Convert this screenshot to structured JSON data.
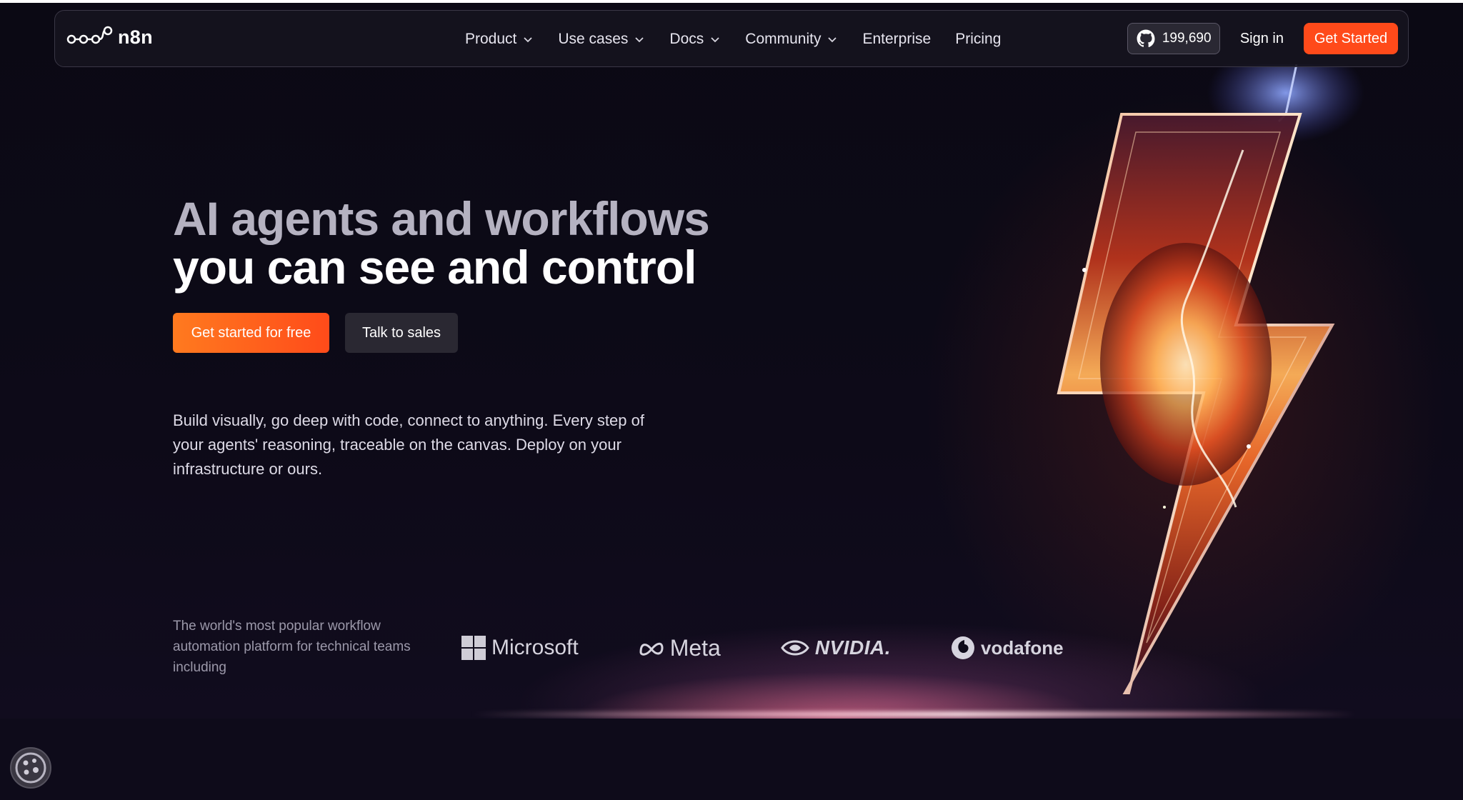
{
  "brand": {
    "name": "n8n"
  },
  "nav": {
    "menu": [
      {
        "label": "Product",
        "dropdown": true
      },
      {
        "label": "Use cases",
        "dropdown": true
      },
      {
        "label": "Docs",
        "dropdown": true
      },
      {
        "label": "Community",
        "dropdown": true
      },
      {
        "label": "Enterprise",
        "dropdown": false
      },
      {
        "label": "Pricing",
        "dropdown": false
      }
    ],
    "github_stars": "199,690",
    "signin_label": "Sign in",
    "get_started_label": "Get Started"
  },
  "hero": {
    "headline_line1": "AI agents and workflows",
    "headline_line2": "you can see and control",
    "cta_primary": "Get started for free",
    "cta_secondary": "Talk to sales",
    "description": "Build visually, go deep with code, connect to anything. Every step of your agents' reasoning, traceable on the canvas. Deploy on your infrastructure or ours."
  },
  "trusted": {
    "text": "The world's most popular workflow automation platform for technical teams including",
    "logos": [
      "Microsoft",
      "Meta",
      "NVIDIA.",
      "vodafone"
    ]
  },
  "colors": {
    "accent": "#ff4a1a",
    "background": "#0e0b1a"
  },
  "icons": {
    "logo": "n8n-nodes-icon",
    "github": "github-icon",
    "chevron": "chevron-down-icon",
    "cookie": "cookie-icon"
  }
}
